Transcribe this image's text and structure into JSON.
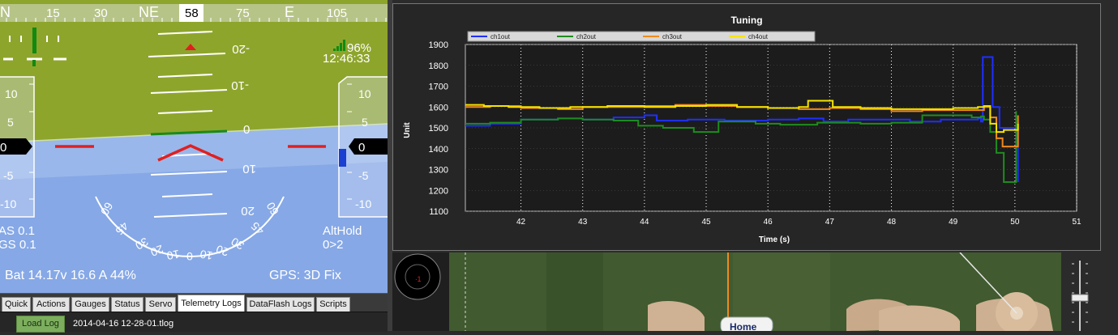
{
  "hud": {
    "heading_scale": [
      "N",
      "15",
      "30",
      "NE",
      "58",
      "75",
      "E",
      "105"
    ],
    "heading_current": "58",
    "pitch_labels": {
      "up20": "-20",
      "up10": "-10",
      "zero": "0",
      "down10": "10",
      "down20": "20"
    },
    "battery_signal": "96%",
    "clock": "12:46:33",
    "airspeed_tape": [
      "10",
      "5",
      "0",
      "-5",
      "-10"
    ],
    "airspeed_value": "0",
    "altitude_tape": [
      "10",
      "5",
      "0",
      "-5",
      "-10"
    ],
    "altitude_value": "0",
    "roll_scale": [
      "60",
      "45",
      "30",
      "20",
      "10",
      "0",
      "10",
      "20",
      "30",
      "45",
      "60"
    ],
    "airspeed_text": "AS 0.1",
    "groundspeed_text": "GS 0.1",
    "mode_text": "AltHold",
    "waypoint_text": "0>2",
    "battery_text": "Bat 14.17v 16.6 A 44%",
    "gps_text": "GPS: 3D Fix",
    "colors": {
      "sky": "#7fa2e4",
      "ground": "#8ea52c",
      "warning": "#e02020",
      "tape": "#ffffff"
    }
  },
  "tabs": [
    {
      "label": "Quick",
      "active": false
    },
    {
      "label": "Actions",
      "active": false
    },
    {
      "label": "Gauges",
      "active": false
    },
    {
      "label": "Status",
      "active": false
    },
    {
      "label": "Servo",
      "active": false
    },
    {
      "label": "Telemetry Logs",
      "active": true
    },
    {
      "label": "DataFlash Logs",
      "active": false
    },
    {
      "label": "Scripts",
      "active": false
    }
  ],
  "logs": {
    "load_button": "Load Log",
    "filename": "2014-04-16 12-28-01.tlog"
  },
  "chart_data": {
    "type": "line",
    "title": "Tuning",
    "xlabel": "Time (s)",
    "ylabel": "Unit",
    "xlim": [
      41.1,
      51
    ],
    "ylim": [
      1100,
      1900
    ],
    "xticks": [
      42,
      43,
      44,
      45,
      46,
      47,
      48,
      49,
      50,
      51
    ],
    "yticks": [
      1100,
      1200,
      1300,
      1400,
      1500,
      1600,
      1700,
      1800,
      1900
    ],
    "grid": true,
    "legend_position": "top-left",
    "series": [
      {
        "name": "ch1out",
        "color": "#1f2fff",
        "points": [
          [
            41.1,
            1510
          ],
          [
            41.5,
            1520
          ],
          [
            42.0,
            1540
          ],
          [
            42.6,
            1545
          ],
          [
            43.0,
            1540
          ],
          [
            43.5,
            1550
          ],
          [
            44.0,
            1560
          ],
          [
            44.2,
            1535
          ],
          [
            44.7,
            1540
          ],
          [
            45.3,
            1535
          ],
          [
            46.0,
            1540
          ],
          [
            46.5,
            1545
          ],
          [
            46.9,
            1530
          ],
          [
            47.3,
            1540
          ],
          [
            47.8,
            1540
          ],
          [
            48.3,
            1530
          ],
          [
            48.8,
            1540
          ],
          [
            49.4,
            1545
          ],
          [
            49.45,
            1530
          ],
          [
            49.48,
            1840
          ],
          [
            49.62,
            1840
          ],
          [
            49.64,
            1600
          ],
          [
            49.75,
            1500
          ],
          [
            50.03,
            1500
          ],
          [
            50.05,
            1240
          ]
        ]
      },
      {
        "name": "ch2out",
        "color": "#1e8c1e",
        "points": [
          [
            41.1,
            1520
          ],
          [
            41.5,
            1525
          ],
          [
            42.0,
            1540
          ],
          [
            42.6,
            1545
          ],
          [
            43.0,
            1540
          ],
          [
            43.5,
            1535
          ],
          [
            43.9,
            1510
          ],
          [
            44.3,
            1500
          ],
          [
            44.8,
            1480
          ],
          [
            45.2,
            1530
          ],
          [
            45.8,
            1520
          ],
          [
            46.2,
            1515
          ],
          [
            46.8,
            1525
          ],
          [
            47.5,
            1520
          ],
          [
            48.0,
            1525
          ],
          [
            48.5,
            1560
          ],
          [
            49.0,
            1560
          ],
          [
            49.3,
            1550
          ],
          [
            49.45,
            1555
          ],
          [
            49.5,
            1540
          ],
          [
            49.6,
            1480
          ],
          [
            49.7,
            1380
          ],
          [
            49.82,
            1240
          ],
          [
            50.0,
            1240
          ],
          [
            50.02,
            1580
          ]
        ]
      },
      {
        "name": "ch3out",
        "color": "#f08a1c",
        "points": [
          [
            41.1,
            1600
          ],
          [
            41.5,
            1605
          ],
          [
            42.0,
            1595
          ],
          [
            42.6,
            1590
          ],
          [
            43.0,
            1600
          ],
          [
            43.5,
            1600
          ],
          [
            44.0,
            1605
          ],
          [
            44.5,
            1610
          ],
          [
            45.0,
            1605
          ],
          [
            45.5,
            1600
          ],
          [
            46.0,
            1595
          ],
          [
            46.5,
            1590
          ],
          [
            47.0,
            1595
          ],
          [
            47.5,
            1590
          ],
          [
            48.0,
            1580
          ],
          [
            48.5,
            1585
          ],
          [
            49.0,
            1585
          ],
          [
            49.4,
            1585
          ],
          [
            49.5,
            1600
          ],
          [
            49.6,
            1550
          ],
          [
            49.7,
            1450
          ],
          [
            49.8,
            1410
          ],
          [
            50.03,
            1410
          ],
          [
            50.05,
            1560
          ]
        ]
      },
      {
        "name": "ch4out",
        "color": "#f5e400",
        "points": [
          [
            41.1,
            1610
          ],
          [
            41.4,
            1605
          ],
          [
            41.8,
            1600
          ],
          [
            42.3,
            1595
          ],
          [
            42.8,
            1600
          ],
          [
            43.4,
            1605
          ],
          [
            44.0,
            1600
          ],
          [
            44.5,
            1605
          ],
          [
            45.0,
            1610
          ],
          [
            45.5,
            1600
          ],
          [
            46.0,
            1595
          ],
          [
            46.5,
            1600
          ],
          [
            46.65,
            1630
          ],
          [
            46.95,
            1630
          ],
          [
            47.05,
            1600
          ],
          [
            47.5,
            1595
          ],
          [
            48.0,
            1590
          ],
          [
            48.5,
            1590
          ],
          [
            49.0,
            1595
          ],
          [
            49.4,
            1600
          ],
          [
            49.5,
            1605
          ],
          [
            49.6,
            1520
          ],
          [
            49.7,
            1480
          ],
          [
            49.82,
            1490
          ],
          [
            50.03,
            1490
          ],
          [
            50.05,
            1520
          ]
        ]
      }
    ]
  },
  "map": {
    "home_label": "Home"
  }
}
